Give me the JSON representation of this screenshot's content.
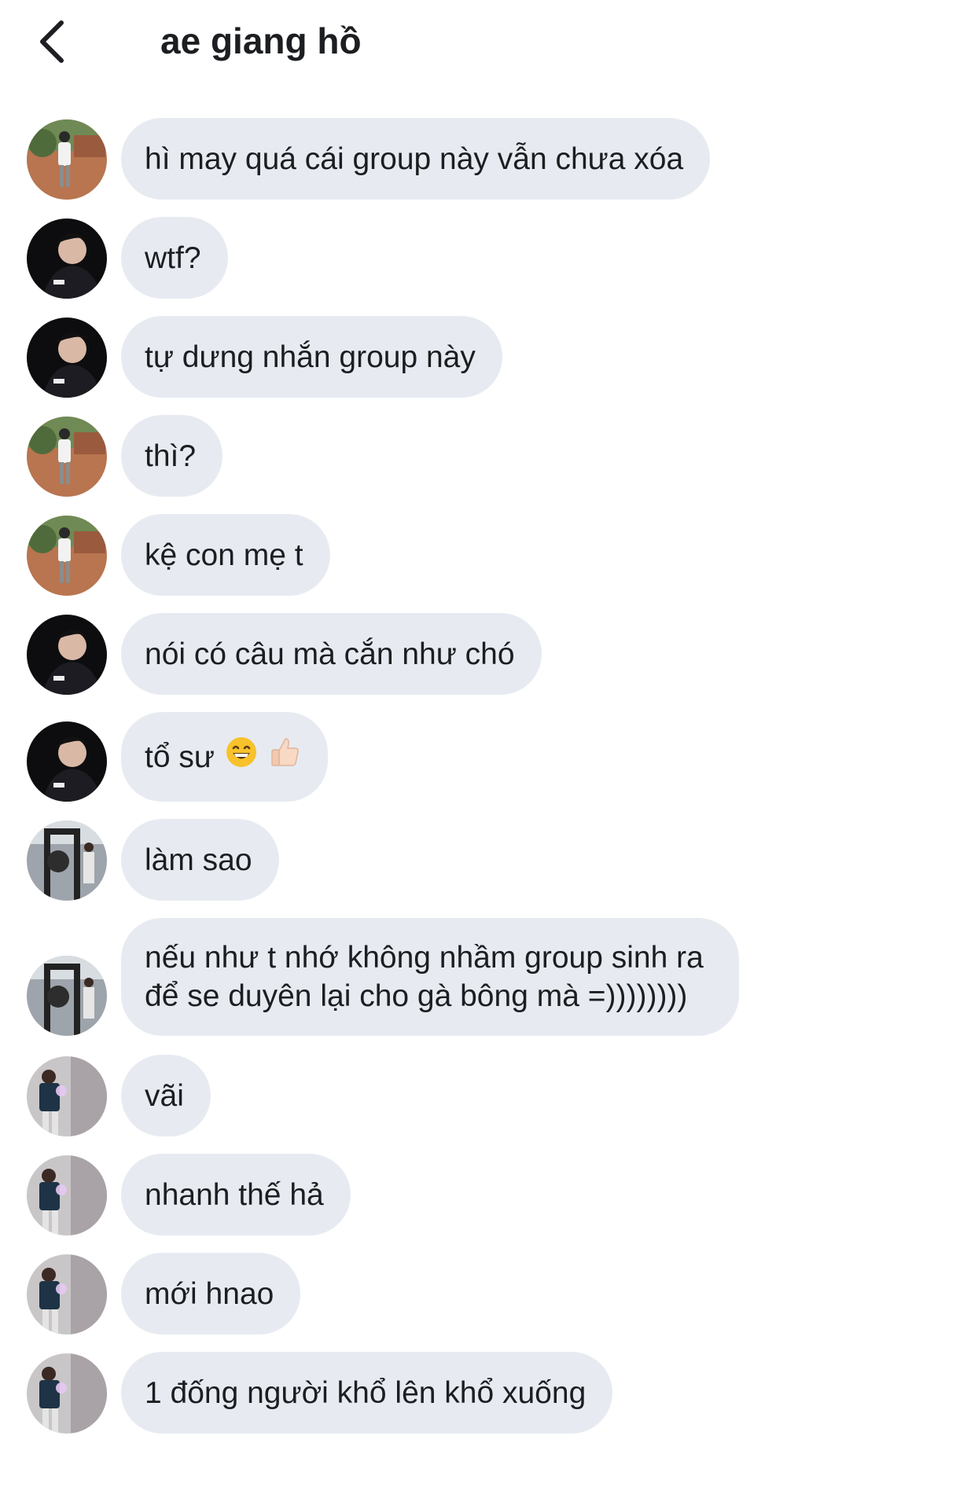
{
  "header": {
    "title": "ae giang hồ",
    "back_icon": "chevron-left-icon"
  },
  "messages": [
    {
      "avatar": "avatar-garden",
      "text": "hì may quá cái group này vẫn chưa xóa"
    },
    {
      "avatar": "avatar-dark",
      "text": "wtf?"
    },
    {
      "avatar": "avatar-dark",
      "text": "tự dưng nhắn group này"
    },
    {
      "avatar": "avatar-garden",
      "text": "thì?"
    },
    {
      "avatar": "avatar-garden",
      "text": "kệ con mẹ t"
    },
    {
      "avatar": "avatar-dark",
      "text": "nói có câu mà cắn như chó"
    },
    {
      "avatar": "avatar-dark",
      "text": "tổ sư",
      "emojis": [
        "grinning-face-emoji",
        "thumbs-up-emoji"
      ]
    },
    {
      "avatar": "avatar-gym",
      "text": "làm sao"
    },
    {
      "avatar": "avatar-gym",
      "text": "nếu như t nhớ không nhầm group sinh ra để se duyên lại cho gà bông mà =))))))))"
    },
    {
      "avatar": "avatar-mirror",
      "text": "vãi"
    },
    {
      "avatar": "avatar-mirror",
      "text": "nhanh thế hả"
    },
    {
      "avatar": "avatar-mirror",
      "text": "mới hnao"
    },
    {
      "avatar": "avatar-mirror",
      "text": "1 đống người khổ lên khổ xuống"
    }
  ],
  "colors": {
    "bubble": "#e7ebf1",
    "text": "#1c1e21",
    "background": "#ffffff"
  }
}
